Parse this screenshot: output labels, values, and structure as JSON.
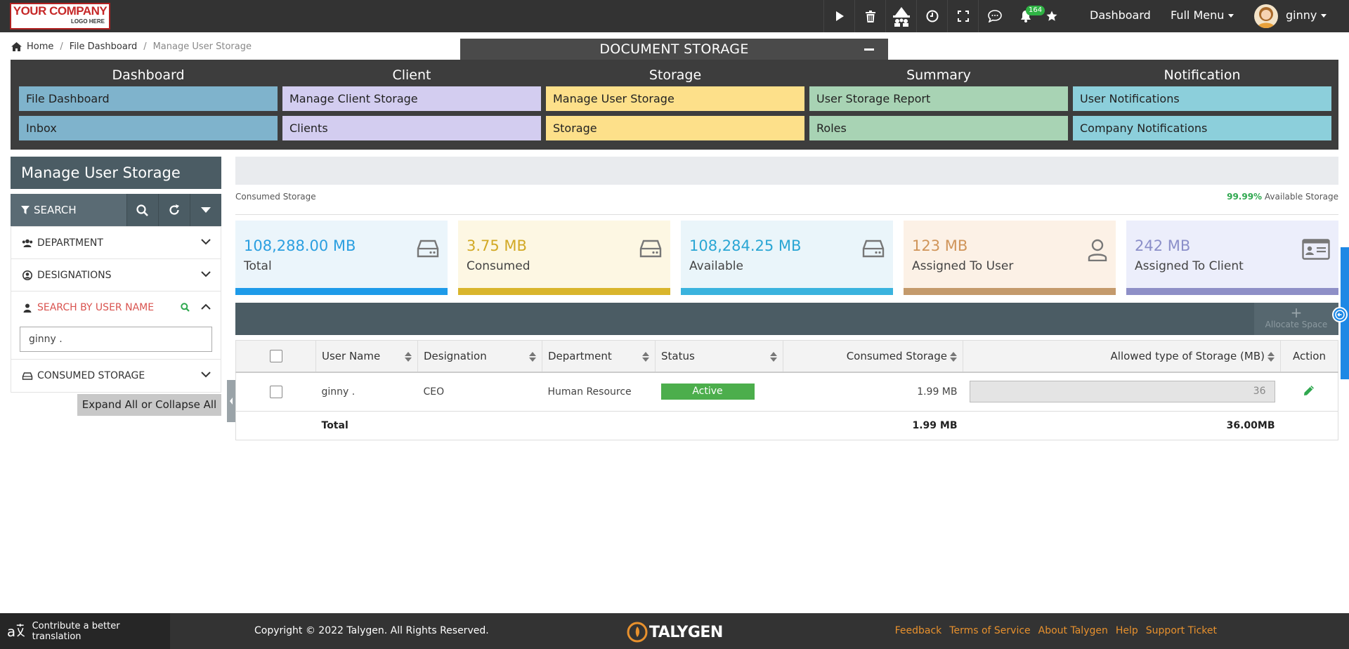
{
  "logo": {
    "line1": "YOUR COMPANY",
    "line2": "LOGO HERE"
  },
  "topbar": {
    "notification_count": "164",
    "dashboard_label": "Dashboard",
    "full_menu_label": "Full Menu",
    "user_name": "ginny"
  },
  "breadcrumb": {
    "home": "Home",
    "file_dashboard": "File Dashboard",
    "current": "Manage User Storage"
  },
  "doc_storage": {
    "title": "DOCUMENT STORAGE",
    "columns": [
      {
        "heading": "Dashboard",
        "color": "#7fb3cc",
        "items": [
          "File Dashboard",
          "Inbox"
        ]
      },
      {
        "heading": "Client",
        "color": "#d3cdf0",
        "items": [
          "Manage Client Storage",
          "Clients"
        ]
      },
      {
        "heading": "Storage",
        "color": "#fde08a",
        "items": [
          "Manage User Storage",
          "Storage"
        ]
      },
      {
        "heading": "Summary",
        "color": "#a8d3b4",
        "items": [
          "User Storage Report",
          "Roles"
        ]
      },
      {
        "heading": "Notification",
        "color": "#8ccfdb",
        "items": [
          "User Notifications",
          "Company Notifications"
        ]
      }
    ]
  },
  "left_panel": {
    "title": "Manage User Storage",
    "search_label": "SEARCH",
    "filters": {
      "department": "DEPARTMENT",
      "designations": "DESIGNATIONS",
      "search_by_user": "SEARCH BY USER NAME",
      "consumed_storage": "CONSUMED STORAGE"
    },
    "user_input_value": "ginny .",
    "expand_label": "Expand All or Collapse All"
  },
  "storage_bar": {
    "consumed_label": "Consumed Storage",
    "available_pct": "99.99%",
    "available_label": "Available Storage"
  },
  "cards": [
    {
      "value": "108,288.00 MB",
      "label": "Total",
      "bg": "#ebf5fb",
      "bar": "#1e9be9",
      "text": "#2b9fe0",
      "icon": "drive-icon"
    },
    {
      "value": "3.75 MB",
      "label": "Consumed",
      "bg": "#fdf7e3",
      "bar": "#d9b52c",
      "text": "#d2a925",
      "icon": "drive-icon"
    },
    {
      "value": "108,284.25 MB",
      "label": "Available",
      "bg": "#eaf5fa",
      "bar": "#3ab3de",
      "text": "#2aa6d4",
      "icon": "drive-icon"
    },
    {
      "value": "123 MB",
      "label": "Assigned To User",
      "bg": "#fcf1e6",
      "bar": "#c49a6c",
      "text": "#d0955a",
      "icon": "user-icon"
    },
    {
      "value": "242 MB",
      "label": "Assigned To Client",
      "bg": "#eceefb",
      "bar": "#8e8fc7",
      "text": "#8b8fc9",
      "icon": "id-card-icon"
    }
  ],
  "toolbar": {
    "allocate_label": "Allocate Space"
  },
  "table": {
    "headers": [
      "User Name",
      "Designation",
      "Department",
      "Status",
      "Consumed Storage",
      "Allowed type of Storage (MB)",
      "Action"
    ],
    "rows": [
      {
        "user": "ginny .",
        "designation": "CEO",
        "department": "Human Resource",
        "status": "Active",
        "consumed": "1.99 MB",
        "allowed": "36"
      }
    ],
    "total": {
      "label": "Total",
      "consumed": "1.99 MB",
      "allowed": "36.00MB"
    }
  },
  "footer": {
    "translate": "Contribute a better translation",
    "copyright": "Copyright © 2022 Talygen. All Rights Reserved.",
    "brand": "TALYGEN",
    "links": [
      "Feedback",
      "Terms of Service",
      "About Talygen",
      "Help",
      "Support Ticket"
    ]
  }
}
